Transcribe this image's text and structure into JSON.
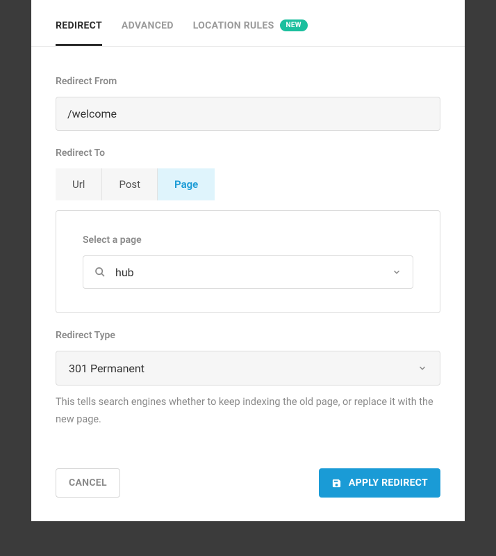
{
  "tabs": {
    "redirect": "Redirect",
    "advanced": "Advanced",
    "location_rules": "Location Rules",
    "new_badge": "New"
  },
  "redirect_from": {
    "label": "Redirect From",
    "value": "/welcome"
  },
  "redirect_to": {
    "label": "Redirect To",
    "options": {
      "url": "Url",
      "post": "Post",
      "page": "Page"
    },
    "page_select": {
      "label": "Select a page",
      "value": "hub"
    }
  },
  "redirect_type": {
    "label": "Redirect Type",
    "value": "301 Permanent",
    "help": "This tells search engines whether to keep indexing the old page, or replace it with the new page."
  },
  "footer": {
    "cancel": "Cancel",
    "apply": "Apply Redirect"
  }
}
